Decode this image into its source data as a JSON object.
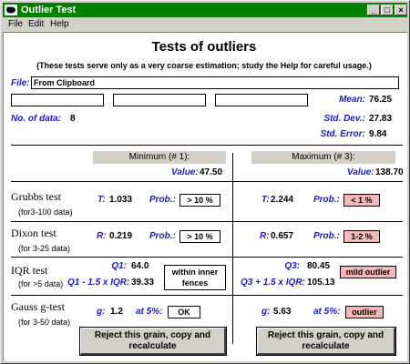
{
  "window": {
    "title": "Outlier Test"
  },
  "menu": [
    "File",
    "Edit",
    "Help"
  ],
  "heading": "Tests of outliers",
  "subheading": "(These tests serve only as a very coarse estimation; study the Help for careful usage.)",
  "file": {
    "label": "File:",
    "value": "From Clipboard"
  },
  "stats": {
    "mean_label": "Mean:",
    "mean": "76.25",
    "n_label": "No. of data:",
    "n": "8",
    "sd_label": "Std. Dev.:",
    "sd": "27.83",
    "se_label": "Std. Error:",
    "se": "9.84"
  },
  "columns": {
    "min_header": "Minimum (# 1):",
    "max_header": "Maximum (# 3):",
    "value_label": "Value:",
    "min_value": "47.50",
    "max_value": "138.70"
  },
  "tests": {
    "grubbs": {
      "name": "Grubbs test",
      "range": "(for3-100 data)",
      "stat_label": "T:",
      "prob_label": "Prob.:",
      "min_stat": "1.033",
      "min_result": "> 10 %",
      "max_stat": "2.244",
      "max_result": "< 1 %"
    },
    "dixon": {
      "name": "Dixon test",
      "range": "(for 3-25 data)",
      "stat_label": "R:",
      "prob_label": "Prob.:",
      "min_stat": "0.219",
      "min_result": "> 10 %",
      "max_stat": "0.657",
      "max_result": "1-2 %"
    },
    "iqr": {
      "name": "IQR test",
      "range": "(for >5 data)",
      "q1_label": "Q1:",
      "q1": "64.0",
      "q1_iqr_label": "Q1 - 1.5 x IQR:",
      "q1_iqr": "39.33",
      "min_result": "within inner fences",
      "q3_label": "Q3:",
      "q3": "80.45",
      "q3_iqr_label": "Q3 + 1.5 x IQR:",
      "q3_iqr": "105.13",
      "max_result": "mild outlier"
    },
    "gauss": {
      "name": "Gauss g-test",
      "range": "(for 3-50 data)",
      "stat_label": "g:",
      "at_label": "at 5%:",
      "min_stat": "1.2",
      "min_result": "OK",
      "max_stat": "5.63",
      "max_result": "outlier"
    }
  },
  "buttons": {
    "reject_label": "Reject this grain, copy and recalculate"
  },
  "colors": {
    "titlebar": "#008000",
    "label_blue": "#1a1acc",
    "flag_pink": "#f4b8b8"
  }
}
